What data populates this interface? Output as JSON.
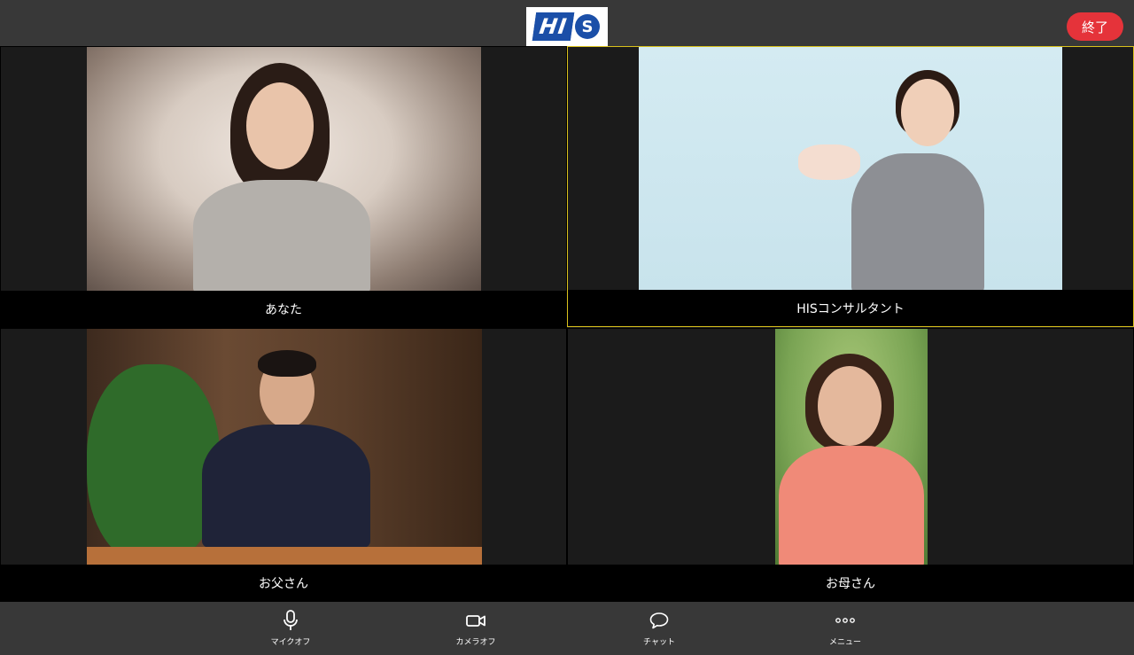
{
  "header": {
    "logo_text_left": "HI",
    "logo_text_right": "S",
    "end_label": "終了"
  },
  "tiles": [
    {
      "name": "あなた"
    },
    {
      "name": "HISコンサルタント"
    },
    {
      "name": "お父さん"
    },
    {
      "name": "お母さん"
    }
  ],
  "controls": {
    "mic_label": "マイクオフ",
    "camera_label": "カメラオフ",
    "chat_label": "チャット",
    "menu_label": "メニュー"
  },
  "colors": {
    "end_button": "#e5333a",
    "active_speaker_border": "#d9c11c",
    "logo_blue": "#1b4fa8"
  }
}
